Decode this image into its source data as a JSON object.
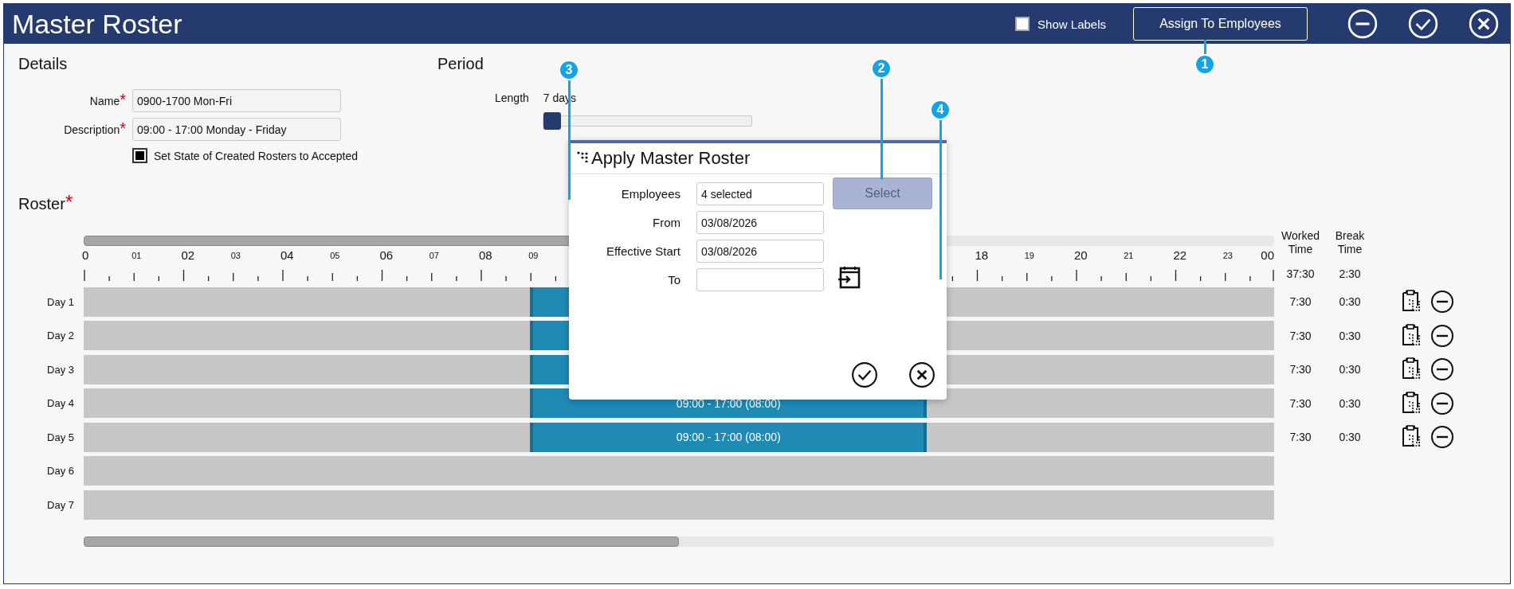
{
  "window": {
    "title": "Master Roster",
    "show_labels": {
      "label": "Show Labels",
      "checked": false
    },
    "assign_button": "Assign To Employees"
  },
  "details": {
    "heading": "Details",
    "fields": [
      {
        "label": "Name",
        "required_mark": "*",
        "value": "0900-1700 Mon-Fri"
      },
      {
        "label": "Description",
        "required_mark": "*",
        "value": "09:00 - 17:00 Monday - Friday"
      }
    ],
    "accepted": {
      "label": "Set State of Created Rosters to Accepted",
      "checked": true
    }
  },
  "period": {
    "heading": "Period",
    "length_label": "Length",
    "length_value": "7 days",
    "level": 0
  },
  "roster": {
    "heading": "Roster",
    "required_mark": "*",
    "hours": [
      "0",
      "01",
      "02",
      "03",
      "04",
      "05",
      "06",
      "07",
      "08",
      "09",
      "18",
      "19",
      "20",
      "21",
      "22",
      "23",
      "00"
    ],
    "worked_header": "Worked Time",
    "break_header": "Break Time",
    "worked_total": "37:30",
    "break_total": "2:30",
    "days": [
      {
        "label": "Day 1",
        "kind": "shift",
        "worked": "7:30",
        "break": "0:30",
        "actions": true
      },
      {
        "label": "Day 2",
        "kind": "shift",
        "worked": "7:30",
        "break": "0:30",
        "actions": true
      },
      {
        "label": "Day 3",
        "kind": "shift",
        "worked": "7:30",
        "break": "0:30",
        "actions": true
      },
      {
        "label": "Day 4",
        "kind": "shift",
        "shift_label": "09:00 - 17:00 (08:00)",
        "worked": "7:30",
        "break": "0:30",
        "actions": true
      },
      {
        "label": "Day 5",
        "kind": "shift",
        "shift_label": "09:00 - 17:00 (08:00)",
        "worked": "7:30",
        "break": "0:30",
        "actions": true
      },
      {
        "label": "Day 6",
        "kind": "off",
        "actions": false
      },
      {
        "label": "Day 7",
        "kind": "off",
        "actions": false
      }
    ]
  },
  "dialog": {
    "title": "Apply Master Roster",
    "fields": [
      {
        "label": "Employees",
        "value": "4 selected"
      },
      {
        "label": "From",
        "value": "03/08/2026"
      },
      {
        "label": "Effective Start",
        "value": "03/08/2026"
      },
      {
        "label": "To"
      }
    ],
    "select_button": {
      "label": "Select",
      "disabled": true
    }
  },
  "callouts": [
    "3",
    "2",
    "1",
    "4"
  ]
}
